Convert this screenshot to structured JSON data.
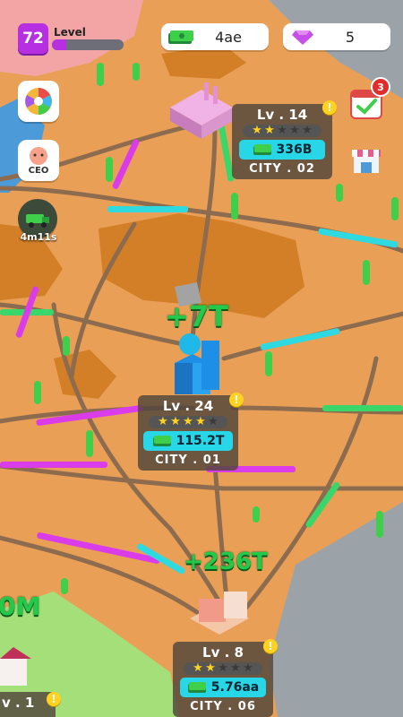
{
  "hud": {
    "player_level": "72",
    "level_label": "Level",
    "level_progress": 0.2,
    "cash": "4ae",
    "gems": "5"
  },
  "side_buttons": {
    "ceo_label": "CEO",
    "boost_timer": "4m11s",
    "calendar_badge": "3"
  },
  "cities": [
    {
      "level": "Lv . 14",
      "stars": 5,
      "stars_on": 2,
      "income": "336B",
      "name": "CITY . 02"
    },
    {
      "level": "Lv . 24",
      "stars": 5,
      "stars_on": 4,
      "income": "115.2T",
      "name": "CITY . 01"
    },
    {
      "level": "Lv . 8",
      "stars": 5,
      "stars_on": 2,
      "income": "5.76aa",
      "name": "CITY . 06"
    },
    {
      "level": "v . 1",
      "stars": 0,
      "stars_on": 0,
      "income": "",
      "name": ""
    }
  ],
  "floating": {
    "gain_1": "+7T",
    "gain_2": "+236T",
    "gain_3": "0M"
  },
  "colors": {
    "accent": "#b62fe0",
    "cash_pill": "#27d7e8",
    "gain_text": "#22c94a",
    "star": "#ffd21f",
    "ground": "#e9a056",
    "water": "#4d9ad8",
    "pink_zone": "#f3a5a5",
    "grass": "#a4df7a"
  },
  "icons": {
    "cash": "cash-stack-icon",
    "gem": "diamond-icon",
    "wheel": "color-wheel-icon",
    "ceo": "ceo-avatar-icon",
    "boost": "money-truck-icon",
    "calendar": "calendar-check-icon",
    "shop": "shop-icon"
  }
}
